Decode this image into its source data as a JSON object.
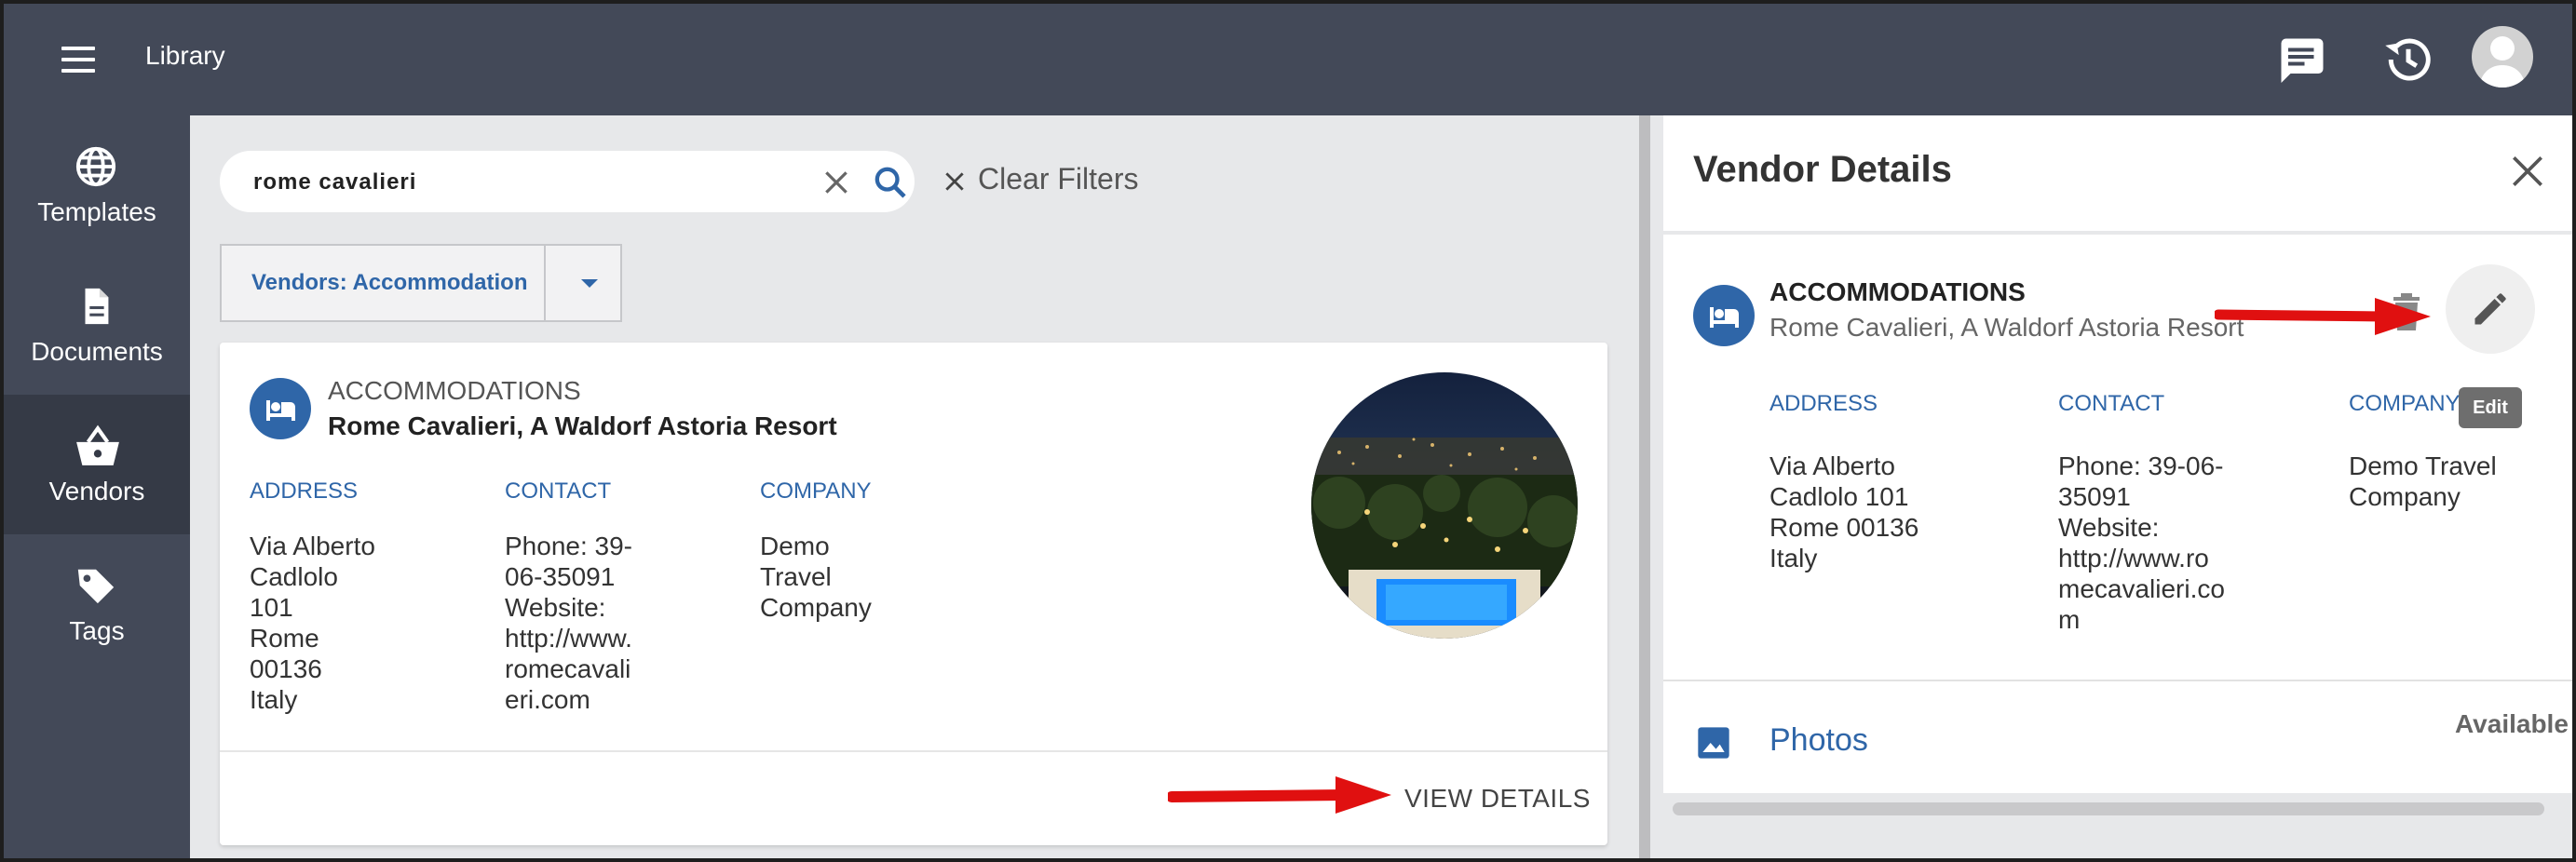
{
  "topbar": {
    "title": "Library",
    "icons": [
      "menu-icon",
      "chat-icon",
      "history-icon",
      "avatar"
    ]
  },
  "nav": {
    "items": [
      {
        "label": "Templates",
        "icon": "globe-icon"
      },
      {
        "label": "Documents",
        "icon": "document-icon"
      },
      {
        "label": "Vendors",
        "icon": "basket-icon",
        "active": true
      },
      {
        "label": "Tags",
        "icon": "tag-icon"
      }
    ]
  },
  "search": {
    "value": "rome cavalieri",
    "clear_filters": "Clear Filters"
  },
  "filter": {
    "selected": "Vendors: Accommodation"
  },
  "card": {
    "category": "ACCOMMODATIONS",
    "name": "Rome Cavalieri, A Waldorf Astoria Resort",
    "address_label": "ADDRESS",
    "address": "Via Alberto\nCadlolo\n101\nRome\n00136\nItaly",
    "contact_label": "CONTACT",
    "contact": "Phone: 39-\n06-35091\nWebsite:\nhttp://www.\nromecavali\neri.com",
    "company_label": "COMPANY",
    "company": "Demo\nTravel\nCompany",
    "view_details": "VIEW DETAILS"
  },
  "details": {
    "title": "Vendor Details",
    "category": "ACCOMMODATIONS",
    "name": "Rome Cavalieri, A Waldorf Astoria Resort",
    "address_label": "ADDRESS",
    "address": "Via Alberto\nCadlolo 101\nRome 00136\nItaly",
    "contact_label": "CONTACT",
    "contact": "Phone: 39-06-\n35091\nWebsite:\nhttp://www.ro\nmecavalieri.co\nm",
    "company_label": "COMPANY",
    "company": "Demo Travel\nCompany",
    "edit_tooltip": "Edit",
    "photos_label": "Photos",
    "available": "Available"
  },
  "colors": {
    "topbar": "#434958",
    "accent": "#2f66a8",
    "annotation_arrow": "#e01010"
  }
}
